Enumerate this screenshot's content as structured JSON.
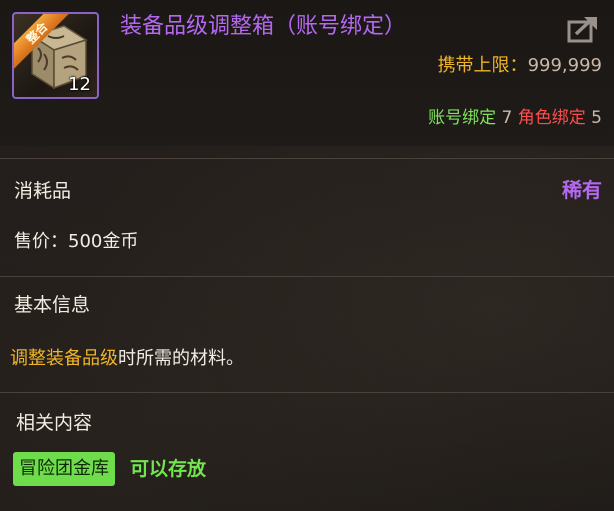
{
  "item": {
    "name": "装备品级调整箱（账号绑定）",
    "icon_name": "equipment-grade-adjust-box-icon",
    "icon_badge": "整合",
    "stack_count": "12",
    "carry_limit_label": "携带上限：",
    "carry_limit_value": "999,999",
    "account_bind_label": "账号绑定",
    "account_bind_count": "7",
    "role_bind_label": "角色绑定",
    "role_bind_count": "5"
  },
  "details": {
    "category": "消耗品",
    "rarity": "稀有",
    "price": "售价：500金币",
    "basic_info_title": "基本信息",
    "description_highlight": "调整装备品级",
    "description_rest": "时所需的材料。",
    "related_title": "相关内容",
    "storage_tag": "冒险团金库",
    "storage_note": "可以存放"
  },
  "colors": {
    "rarity_purple": "#b468f0",
    "gold": "#f0b428",
    "account_green": "#7ee25c",
    "role_red": "#ff4d4d",
    "storage_green": "#6fdc4c"
  }
}
